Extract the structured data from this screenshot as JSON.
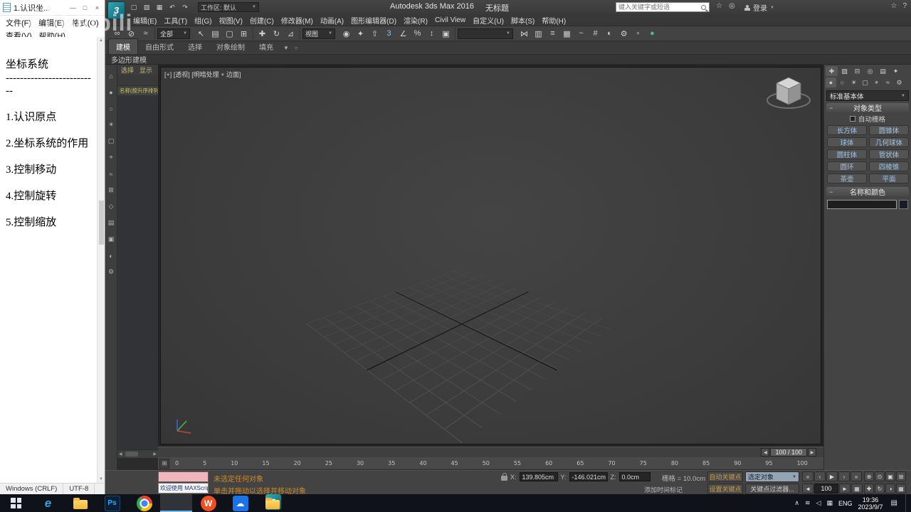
{
  "watermark": {
    "brand": "bilibili"
  },
  "notepad": {
    "title": "1.认识坐...",
    "min": "—",
    "max_btn": "□",
    "close": "×",
    "scroll_up": "▲",
    "scroll_down": "▼",
    "menus1": [
      {
        "label": "文件(F)",
        "name": "menu-file"
      },
      {
        "label": "编辑(E)",
        "name": "menu-edit"
      },
      {
        "label": "格式(O)",
        "name": "menu-format"
      }
    ],
    "menus2": [
      {
        "label": "查看(V)",
        "name": "menu-view"
      },
      {
        "label": "帮助(H)",
        "name": "menu-help"
      }
    ],
    "lines": [
      {
        "t": "坐标系统"
      },
      {
        "t": "------------------------"
      },
      {
        "t": "--"
      },
      {
        "t": ""
      },
      {
        "t": "1.认识原点"
      },
      {
        "t": ""
      },
      {
        "t": "2.坐标系统的作用"
      },
      {
        "t": ""
      },
      {
        "t": "3.控制移动"
      },
      {
        "t": ""
      },
      {
        "t": "4.控制旋转"
      },
      {
        "t": ""
      },
      {
        "t": "5.控制缩放"
      }
    ],
    "status1": "Windows (CRLF)",
    "status2": "UTF-8"
  },
  "max": {
    "logo": "3",
    "title_app": "Autodesk 3ds Max 2016",
    "title_doc": "无标题",
    "workspace": "工作区: 默认",
    "search_placeholder": "键入关键字或短语",
    "signin": "登录",
    "caret": "▼",
    "arrow_l": "◀",
    "arrow_r": "▶",
    "qa": [
      {
        "name": "new-scene-icon",
        "g": "▢"
      },
      {
        "name": "open-file-icon",
        "g": "▧"
      },
      {
        "name": "save-file-icon",
        "g": "▦"
      },
      {
        "name": "undo-icon",
        "g": "↶"
      },
      {
        "name": "redo-icon",
        "g": "↷"
      }
    ],
    "ic": [
      {
        "name": "favorites-icon",
        "g": "☆"
      },
      {
        "name": "help-icon",
        "g": "?"
      }
    ],
    "menus": [
      {
        "label": "编辑(E)",
        "name": "menu-edit"
      },
      {
        "label": "工具(T)",
        "name": "menu-tools"
      },
      {
        "label": "组(G)",
        "name": "menu-group"
      },
      {
        "label": "视图(V)",
        "name": "menu-views"
      },
      {
        "label": "创建(C)",
        "name": "menu-create"
      },
      {
        "label": "修改器(M)",
        "name": "menu-modifiers"
      },
      {
        "label": "动画(A)",
        "name": "menu-animation"
      },
      {
        "label": "图形编辑器(D)",
        "name": "menu-graph-editors"
      },
      {
        "label": "渲染(R)",
        "name": "menu-rendering"
      },
      {
        "label": "Civil View",
        "name": "menu-civil-view"
      },
      {
        "label": "自定义(U)",
        "name": "menu-customize"
      },
      {
        "label": "脚本(S)",
        "name": "menu-scripting"
      },
      {
        "label": "帮助(H)",
        "name": "menu-help"
      }
    ],
    "filter_all": "全部",
    "coord_view": "视图",
    "tb1": [
      {
        "name": "select-and-link-icon",
        "g": "∞"
      },
      {
        "name": "unlink-selection-icon",
        "g": "⊘"
      },
      {
        "name": "bind-to-space-warp-icon",
        "g": "≈"
      }
    ],
    "tb2": [
      {
        "name": "select-object-icon",
        "g": "↖"
      },
      {
        "name": "select-by-name-icon",
        "g": "▤"
      },
      {
        "name": "rectangular-selection-region-icon",
        "g": "▢"
      },
      {
        "name": "window-crossing-icon",
        "g": "⊞"
      }
    ],
    "tb3": [
      {
        "name": "select-and-move-icon",
        "g": "✚"
      },
      {
        "name": "select-and-rotate-icon",
        "g": "↻"
      },
      {
        "name": "select-and-uniform-scale-icon",
        "g": "⊿"
      }
    ],
    "tb4": [
      {
        "name": "use-pivot-point-center-icon",
        "g": "◉"
      },
      {
        "name": "select-and-manipulate-icon",
        "g": "✦"
      },
      {
        "name": "keyboard-shortcut-override-icon",
        "g": "⇧"
      },
      {
        "name": "snaps-toggle-3d-icon",
        "g": "3",
        "c": "#7fc8e8"
      },
      {
        "name": "angle-snap-icon",
        "g": "∠"
      },
      {
        "name": "percent-snap-icon",
        "g": "%"
      },
      {
        "name": "spinner-snap-icon",
        "g": "↕"
      },
      {
        "name": "edit-named-selection-sets-icon",
        "g": "▣"
      }
    ],
    "tb5": [
      {
        "name": "mirror-icon",
        "g": "⋈"
      },
      {
        "name": "align-icon",
        "g": "▥"
      },
      {
        "name": "layer-manager-icon",
        "g": "≡"
      },
      {
        "name": "ribbon-toggle-icon",
        "g": "▦"
      },
      {
        "name": "curve-editor-icon",
        "g": "~"
      },
      {
        "name": "schematic-view-icon",
        "g": "#"
      },
      {
        "name": "material-editor-icon",
        "g": "◐"
      },
      {
        "name": "render-setup-icon",
        "g": "⚙"
      },
      {
        "name": "rendered-frame-window-icon",
        "g": "▫"
      },
      {
        "name": "render-production-icon",
        "g": "●",
        "c": "#4fb3a8"
      }
    ],
    "ribbon_tabs": [
      {
        "label": "建模",
        "name": "ribbon-tab-modeling",
        "cls": "rtab active"
      },
      {
        "label": "自由形式",
        "name": "ribbon-tab-freeform"
      },
      {
        "label": "选择",
        "name": "ribbon-tab-selection"
      },
      {
        "label": "对象绘制",
        "name": "ribbon-tab-object-paint"
      },
      {
        "label": "填充",
        "name": "ribbon-tab-populate"
      }
    ],
    "ribbon_pin": "○",
    "ribbon_panel": "多边形建模",
    "se_menus": [
      {
        "label": "选择",
        "name": "explorer-menu-select"
      },
      {
        "label": "显示",
        "name": "explorer-menu-display"
      }
    ],
    "se_header": "名称(按升序排列)",
    "se_tools": [
      {
        "name": "se-find-icon",
        "g": "⌂"
      },
      {
        "name": "se-geometry-filter-icon",
        "g": "●"
      },
      {
        "name": "se-shapes-filter-icon",
        "g": "○"
      },
      {
        "name": "se-lights-filter-icon",
        "g": "☀"
      },
      {
        "name": "se-cameras-filter-icon",
        "g": "▢"
      },
      {
        "name": "se-helpers-filter-icon",
        "g": "⌖"
      },
      {
        "name": "se-spacewarps-filter-icon",
        "g": "≈"
      },
      {
        "name": "se-groups-filter-icon",
        "g": "⊞"
      },
      {
        "name": "se-xref-filter-icon",
        "g": "◇"
      },
      {
        "name": "se-bones-filter-icon",
        "g": "▤"
      },
      {
        "name": "se-containers-filter-icon",
        "g": "▣"
      },
      {
        "name": "se-materials-filter-icon",
        "g": "◐"
      },
      {
        "name": "se-settings-icon",
        "g": "⚙"
      }
    ],
    "vp_label": "[+] [透视] [明暗处理 + 边面]",
    "ts_frame": "100 / 100",
    "ticks": [
      {
        "t": "0"
      },
      {
        "t": "5"
      },
      {
        "t": "10"
      },
      {
        "t": "15"
      },
      {
        "t": "20"
      },
      {
        "t": "25"
      },
      {
        "t": "30"
      },
      {
        "t": "35"
      },
      {
        "t": "40"
      },
      {
        "t": "45"
      },
      {
        "t": "50"
      },
      {
        "t": "55"
      },
      {
        "t": "60"
      },
      {
        "t": "65"
      },
      {
        "t": "70"
      },
      {
        "t": "75"
      },
      {
        "t": "80"
      },
      {
        "t": "85"
      },
      {
        "t": "90"
      },
      {
        "t": "95"
      },
      {
        "t": "100"
      }
    ],
    "cmd_tabs": [
      {
        "name": "create-tab-icon",
        "g": "✚",
        "cls": "ct active"
      },
      {
        "name": "modify-tab-icon",
        "g": "▧"
      },
      {
        "name": "hierarchy-tab-icon",
        "g": "⊟"
      },
      {
        "name": "motion-tab-icon",
        "g": "◎"
      },
      {
        "name": "display-tab-icon",
        "g": "▤"
      },
      {
        "name": "utilities-tab-icon",
        "g": "✦"
      }
    ],
    "cmd_cats": [
      {
        "name": "geometry-category-icon",
        "g": "●",
        "cls": "cat active"
      },
      {
        "name": "shapes-category-icon",
        "g": "○"
      },
      {
        "name": "lights-category-icon",
        "g": "☀"
      },
      {
        "name": "cameras-category-icon",
        "g": "▢"
      },
      {
        "name": "helpers-category-icon",
        "g": "⌖"
      },
      {
        "name": "space-warps-category-icon",
        "g": "≈"
      },
      {
        "name": "systems-category-icon",
        "g": "⚙"
      }
    ],
    "class_dropdown": "标准基本体",
    "collapse": "−",
    "roll_objtype": "对象类型",
    "autogrid": "自动栅格",
    "objects": [
      {
        "label": "长方体",
        "name": "box-button"
      },
      {
        "label": "圆锥体",
        "name": "cone-button"
      },
      {
        "label": "球体",
        "name": "sphere-button"
      },
      {
        "label": "几何球体",
        "name": "geosphere-button"
      },
      {
        "label": "圆柱体",
        "name": "cylinder-button"
      },
      {
        "label": "管状体",
        "name": "tube-button"
      },
      {
        "label": "圆环",
        "name": "torus-button"
      },
      {
        "label": "四棱锥",
        "name": "pyramid-button"
      },
      {
        "label": "茶壶",
        "name": "teapot-button"
      },
      {
        "label": "平面",
        "name": "plane-button"
      }
    ],
    "roll_namecolor": "名称和颜色",
    "status": {
      "sel": "未选定任何对象",
      "welcome": "欢迎使用 MAXScript",
      "prompt": "单击并拖动以选择并移动对象",
      "xl": "X:",
      "xv": "139.805cm",
      "yl": "Y:",
      "yv": "-146.021cm",
      "zl": "Z:",
      "zv": "0.0cm",
      "grid": "栅格 = 10.0cm",
      "timetag": "添加时间标记",
      "autokey": "自动关键点",
      "setkey": "设置关键点",
      "selfilter": "选定对象",
      "keyfilters": "关键点过滤器...",
      "frame": "100"
    },
    "play1": [
      {
        "name": "go-to-start-button",
        "g": "«"
      },
      {
        "name": "previous-frame-button",
        "g": "‹"
      },
      {
        "name": "play-button",
        "g": "▶"
      },
      {
        "name": "next-frame-button",
        "g": "›"
      },
      {
        "name": "go-to-end-button",
        "g": "»"
      }
    ],
    "play2a": [
      {
        "name": "key-mode-toggle-button",
        "g": "◄"
      }
    ],
    "play2b": [
      {
        "name": "next-key-button",
        "g": "►"
      },
      {
        "name": "time-configuration-button",
        "g": "▦"
      }
    ],
    "nav1": [
      {
        "name": "zoom-icon",
        "g": "⊕"
      },
      {
        "name": "zoom-all-icon",
        "g": "⊙"
      },
      {
        "name": "zoom-extents-icon",
        "g": "▣"
      },
      {
        "name": "zoom-extents-all-icon",
        "g": "⊞"
      }
    ],
    "nav2": [
      {
        "name": "pan-icon",
        "g": "✚"
      },
      {
        "name": "orbit-icon",
        "g": "↻"
      },
      {
        "name": "field-of-view-icon",
        "g": "◑"
      },
      {
        "name": "maximize-viewport-icon",
        "g": "▦"
      }
    ]
  },
  "taskbar": {
    "apps": [
      {
        "name": "taskbar-edge-icon",
        "g": "e",
        "cls": "ta edge"
      },
      {
        "name": "taskbar-explorer-icon",
        "g": "",
        "cls": "ta folder"
      },
      {
        "name": "taskbar-photoshop-icon",
        "g": "Ps",
        "cls": "ta ps"
      },
      {
        "name": "taskbar-chrome-icon",
        "g": "",
        "cls": "ta chrome"
      },
      {
        "name": "taskbar-3dsmax-icon",
        "g": "3",
        "cls": "ta max",
        "active": "tb-slot active"
      },
      {
        "name": "taskbar-wps-icon",
        "g": "W",
        "cls": "ta wps"
      },
      {
        "name": "taskbar-cloud-app-icon",
        "g": "☁",
        "cls": "ta cloudapp"
      },
      {
        "name": "taskbar-folder-icon",
        "g": "",
        "cls": "ta folder"
      }
    ],
    "tray": [
      {
        "name": "hidden-icons-chevron",
        "g": "∧"
      },
      {
        "name": "network-icon",
        "g": "≋"
      },
      {
        "name": "volume-icon",
        "g": "◁"
      },
      {
        "name": "ime-icon",
        "g": "▦"
      }
    ],
    "lang": "ENG",
    "time": "19:36",
    "date": "2023/9/7",
    "notif": "▤"
  }
}
